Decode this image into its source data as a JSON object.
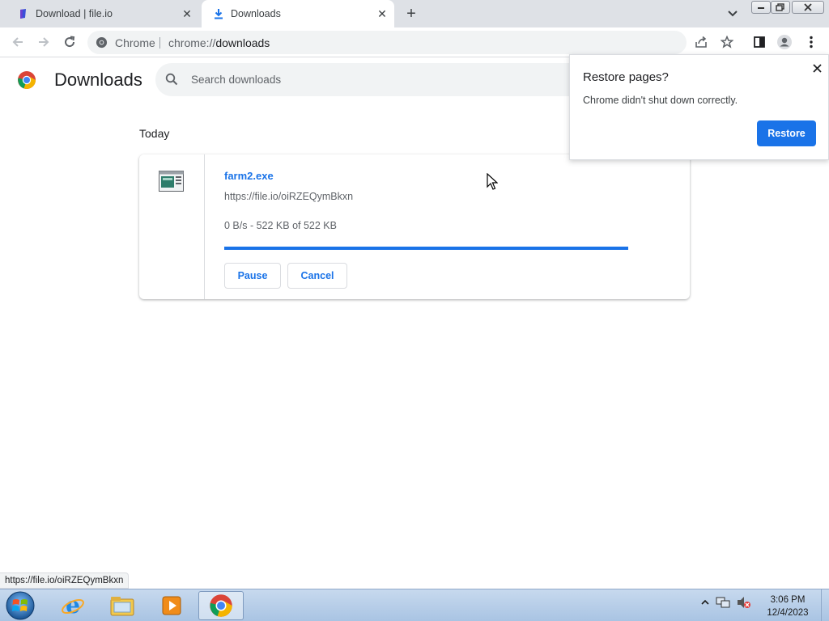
{
  "browser": {
    "tabs": [
      {
        "title": "Download | file.io",
        "favicon": "fileio-logo-icon",
        "active": false
      },
      {
        "title": "Downloads",
        "favicon": "download-arrow-icon",
        "active": true
      }
    ],
    "new_tab_symbol": "+",
    "close_symbol": "✕",
    "omnibox": {
      "site_label": "Chrome",
      "url_scheme": "chrome://",
      "url_path": "downloads"
    },
    "toolbar_icons": [
      "back-icon",
      "forward-icon",
      "reload-icon",
      "share-icon",
      "star-icon",
      "side-panel-icon",
      "profile-icon",
      "menu-icon"
    ]
  },
  "downloads_page": {
    "title": "Downloads",
    "search_placeholder": "Search downloads",
    "section_label": "Today",
    "items": [
      {
        "file_name": "farm2.exe",
        "url": "https://file.io/oiRZEQymBkxn",
        "status": "0 B/s - 522 KB of 522 KB",
        "progress_fraction": 1.0,
        "buttons": {
          "pause": "Pause",
          "cancel": "Cancel"
        }
      }
    ]
  },
  "restore_popup": {
    "title": "Restore pages?",
    "message": "Chrome didn't shut down correctly.",
    "button": "Restore"
  },
  "status_bar": {
    "link": "https://file.io/oiRZEQymBkxn"
  },
  "taskbar": {
    "apps": [
      "internet-explorer-icon",
      "file-explorer-icon",
      "media-player-icon",
      "chrome-icon"
    ],
    "clock_time": "3:06 PM",
    "clock_date": "12/4/2023"
  },
  "colors": {
    "accent": "#1a73e8",
    "tabstrip": "#dee1e6"
  }
}
